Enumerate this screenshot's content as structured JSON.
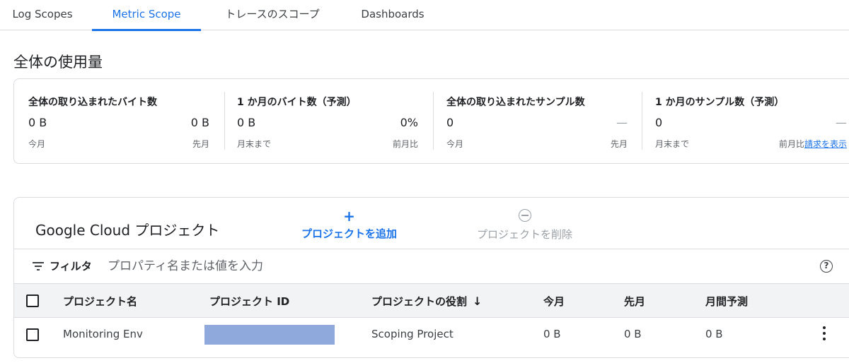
{
  "tabs": [
    {
      "label": "Log Scopes"
    },
    {
      "label": "Metric Scope",
      "active": true
    },
    {
      "label": "トレースのスコープ"
    },
    {
      "label": "Dashboards"
    }
  ],
  "usage": {
    "title": "全体の使用量",
    "metrics": [
      {
        "title": "全体の取り込まれたバイト数",
        "value": "0 B",
        "compare": "0 B",
        "sub_left": "今月",
        "sub_right": "先月"
      },
      {
        "title": "1 か月のバイト数（予測）",
        "value": "0 B",
        "compare": "0%",
        "sub_left": "月末まで",
        "sub_right": "前月比"
      },
      {
        "title": "全体の取り込まれたサンプル数",
        "value": "0",
        "compare": "—",
        "sub_left": "今月",
        "sub_right": "先月"
      },
      {
        "title": "1 か月のサンプル数（予測）",
        "value": "0",
        "compare": "—",
        "sub_left": "月末まで",
        "sub_right": "前月比",
        "link": "請求を表示"
      }
    ]
  },
  "projects": {
    "title": "Google Cloud プロジェクト",
    "add_label": "プロジェクトを追加",
    "delete_label": "プロジェクトを削除",
    "filter": {
      "label": "フィルタ",
      "placeholder": "プロパティ名または値を入力"
    },
    "columns": [
      "プロジェクト名",
      "プロジェクト ID",
      "プロジェクトの役割",
      "今月",
      "先月",
      "月間予測"
    ],
    "rows": [
      {
        "name": "Monitoring Env",
        "id": "",
        "role": "Scoping Project",
        "this_month": "0 B",
        "last_month": "0 B",
        "forecast": "0 B"
      }
    ]
  },
  "colors": {
    "accent": "#1a73e8",
    "redaction": "#8fa9dd"
  }
}
